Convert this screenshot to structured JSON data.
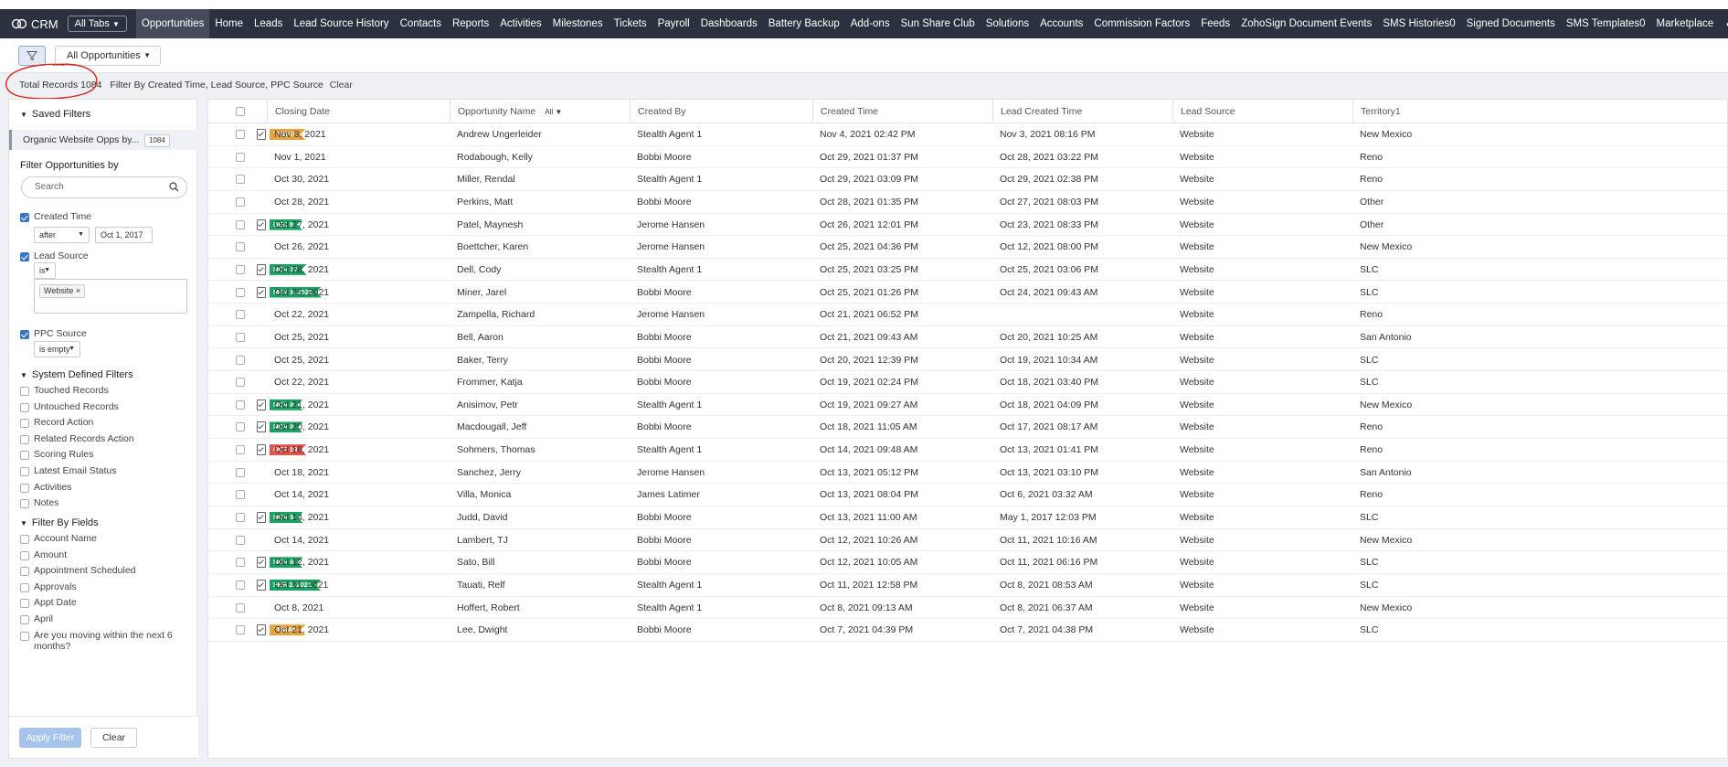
{
  "app": {
    "logo_text": "CRM",
    "all_tabs_label": "All Tabs"
  },
  "nav": {
    "tabs": [
      "Opportunities",
      "Home",
      "Leads",
      "Lead Source History",
      "Contacts",
      "Reports",
      "Activities",
      "Milestones",
      "Tickets",
      "Payroll",
      "Dashboards",
      "Battery Backup",
      "Add-ons",
      "Sun Share Club",
      "Solutions",
      "Accounts",
      "Commission Factors",
      "Feeds",
      "ZohoSign Document Events",
      "SMS Histories0",
      "Signed Documents",
      "SMS Templates0",
      "Marketplace"
    ],
    "active": "Opportunities",
    "more": "•••"
  },
  "toolbar": {
    "view_label": "All Opportunities"
  },
  "info": {
    "total_label": "Total Records",
    "total_value": "1084",
    "filter_text": "Filter By Created Time, Lead Source, PPC Source",
    "clear_label": "Clear"
  },
  "sidebar": {
    "saved_filters_label": "Saved Filters",
    "saved_item_label": "Organic Website Opps by...",
    "saved_item_count": "1084",
    "filter_by_label": "Filter Opportunities by",
    "search_placeholder": "Search",
    "created_time": {
      "label": "Created Time",
      "operator": "after",
      "value": "Oct 1, 2017"
    },
    "lead_source": {
      "label": "Lead Source",
      "operator": "is",
      "token": "Website"
    },
    "ppc_source": {
      "label": "PPC Source",
      "operator": "is empty"
    },
    "system_filters_label": "System Defined Filters",
    "system_filters": [
      "Touched Records",
      "Untouched Records",
      "Record Action",
      "Related Records Action",
      "Scoring Rules",
      "Latest Email Status",
      "Activities",
      "Notes"
    ],
    "field_filters_label": "Filter By Fields",
    "field_filters": [
      "Account Name",
      "Amount",
      "Appointment Scheduled",
      "Approvals",
      "Appt Date",
      "April",
      "Are you moving within the next 6 months?"
    ],
    "apply_label": "Apply Filter",
    "clear_label": "Clear"
  },
  "table": {
    "columns": [
      "Closing Date",
      "Opportunity Name",
      "Created By",
      "Created Time",
      "Lead Created Time",
      "Lead Source",
      "Territory1"
    ],
    "name_filter": "All",
    "rows": [
      {
        "tag": "TODAY",
        "tag_color": "#e8a33c",
        "closing": "Nov 8, 2021",
        "name": "Andrew Ungerleider",
        "created_by": "Stealth Agent 1",
        "created_time": "Nov 4, 2021 02:42 PM",
        "lead_created": "Nov 3, 2021 08:16 PM",
        "source": "Website",
        "territory": "New Mexico"
      },
      {
        "tag": "",
        "tag_color": "",
        "closing": "Nov 1, 2021",
        "name": "Rodabough, Kelly",
        "created_by": "Bobbi Moore",
        "created_time": "Oct 29, 2021 01:37 PM",
        "lead_created": "Oct 28, 2021 03:22 PM",
        "source": "Website",
        "territory": "Reno"
      },
      {
        "tag": "",
        "tag_color": "",
        "closing": "Oct 30, 2021",
        "name": "Miller, Rendal",
        "created_by": "Stealth Agent 1",
        "created_time": "Oct 29, 2021 03:09 PM",
        "lead_created": "Oct 29, 2021 02:38 PM",
        "source": "Website",
        "territory": "Reno"
      },
      {
        "tag": "",
        "tag_color": "",
        "closing": "Oct 28, 2021",
        "name": "Perkins, Matt",
        "created_by": "Bobbi Moore",
        "created_time": "Oct 28, 2021 01:35 PM",
        "lead_created": "Oct 27, 2021 08:03 PM",
        "source": "Website",
        "territory": "Other"
      },
      {
        "tag": "DEC 8",
        "tag_color": "#1aa260",
        "closing": "Oct 27, 2021",
        "name": "Patel, Maynesh",
        "created_by": "Jerome Hansen",
        "created_time": "Oct 26, 2021 12:01 PM",
        "lead_created": "Oct 23, 2021 08:33 PM",
        "source": "Website",
        "territory": "Other"
      },
      {
        "tag": "",
        "tag_color": "",
        "closing": "Oct 26, 2021",
        "name": "Boettcher, Karen",
        "created_by": "Jerome Hansen",
        "created_time": "Oct 25, 2021 04:36 PM",
        "lead_created": "Oct 12, 2021 08:00 PM",
        "source": "Website",
        "territory": "New Mexico"
      },
      {
        "tag": "NOV 17",
        "tag_color": "#1aa260",
        "closing": "Oct 28, 2021",
        "name": "Dell, Cody",
        "created_by": "Stealth Agent 1",
        "created_time": "Oct 25, 2021 03:25 PM",
        "lead_created": "Oct 25, 2021 03:06 PM",
        "source": "Website",
        "territory": "SLC"
      },
      {
        "tag": "MAY 3, 2022",
        "tag_color": "#1aa260",
        "closing": "Oct 25, 2021",
        "name": "Miner, Jarel",
        "created_by": "Bobbi Moore",
        "created_time": "Oct 25, 2021 01:26 PM",
        "lead_created": "Oct 24, 2021 09:43 AM",
        "source": "Website",
        "territory": "SLC"
      },
      {
        "tag": "",
        "tag_color": "",
        "closing": "Oct 22, 2021",
        "name": "Zampella, Richard",
        "created_by": "Jerome Hansen",
        "created_time": "Oct 21, 2021 06:52 PM",
        "lead_created": "",
        "source": "Website",
        "territory": "Reno"
      },
      {
        "tag": "",
        "tag_color": "",
        "closing": "Oct 25, 2021",
        "name": "Bell, Aaron",
        "created_by": "Bobbi Moore",
        "created_time": "Oct 21, 2021 09:43 AM",
        "lead_created": "Oct 20, 2021 10:25 AM",
        "source": "Website",
        "territory": "San Antonio"
      },
      {
        "tag": "",
        "tag_color": "",
        "closing": "Oct 25, 2021",
        "name": "Baker, Terry",
        "created_by": "Bobbi Moore",
        "created_time": "Oct 20, 2021 12:39 PM",
        "lead_created": "Oct 19, 2021 10:34 AM",
        "source": "Website",
        "territory": "SLC"
      },
      {
        "tag": "",
        "tag_color": "",
        "closing": "Oct 22, 2021",
        "name": "Frommer, Katja",
        "created_by": "Bobbi Moore",
        "created_time": "Oct 19, 2021 02:24 PM",
        "lead_created": "Oct 18, 2021 03:40 PM",
        "source": "Website",
        "territory": "SLC"
      },
      {
        "tag": "NOV 8",
        "tag_color": "#1aa260",
        "closing": "Oct 21, 2021",
        "name": "Anisimov, Petr",
        "created_by": "Stealth Agent 1",
        "created_time": "Oct 19, 2021 09:27 AM",
        "lead_created": "Oct 18, 2021 04:09 PM",
        "source": "Website",
        "territory": "New Mexico"
      },
      {
        "tag": "NOV 8",
        "tag_color": "#1aa260",
        "closing": "Oct 20, 2021",
        "name": "Macdougall, Jeff",
        "created_by": "Bobbi Moore",
        "created_time": "Oct 18, 2021 11:05 AM",
        "lead_created": "Oct 17, 2021 08:17 AM",
        "source": "Website",
        "territory": "Reno"
      },
      {
        "tag": "OCT 19",
        "tag_color": "#e5534b",
        "closing": "Oct 16, 2021",
        "name": "Sohmers, Thomas",
        "created_by": "Stealth Agent 1",
        "created_time": "Oct 14, 2021 09:48 AM",
        "lead_created": "Oct 13, 2021 01:41 PM",
        "source": "Website",
        "territory": "Reno"
      },
      {
        "tag": "",
        "tag_color": "",
        "closing": "Oct 18, 2021",
        "name": "Sanchez, Jerry",
        "created_by": "Jerome Hansen",
        "created_time": "Oct 13, 2021 05:12 PM",
        "lead_created": "Oct 13, 2021 03:10 PM",
        "source": "Website",
        "territory": "San Antonio"
      },
      {
        "tag": "",
        "tag_color": "",
        "closing": "Oct 14, 2021",
        "name": "Villa, Monica",
        "created_by": "James Latimer",
        "created_time": "Oct 13, 2021 08:04 PM",
        "lead_created": "Oct 6, 2021 03:32 AM",
        "source": "Website",
        "territory": "Reno"
      },
      {
        "tag": "NOV 5",
        "tag_color": "#1aa260",
        "closing": "Oct 14, 2021",
        "name": "Judd, David",
        "created_by": "Bobbi Moore",
        "created_time": "Oct 13, 2021 11:00 AM",
        "lead_created": "May 1, 2017 12:03 PM",
        "source": "Website",
        "territory": "SLC"
      },
      {
        "tag": "",
        "tag_color": "",
        "closing": "Oct 14, 2021",
        "name": "Lambert, TJ",
        "created_by": "Bobbi Moore",
        "created_time": "Oct 12, 2021 10:26 AM",
        "lead_created": "Oct 11, 2021 10:16 AM",
        "source": "Website",
        "territory": "New Mexico"
      },
      {
        "tag": "NOV 8",
        "tag_color": "#1aa260",
        "closing": "Oct 12, 2021",
        "name": "Sato, Bill",
        "created_by": "Bobbi Moore",
        "created_time": "Oct 12, 2021 10:05 AM",
        "lead_created": "Oct 11, 2021 06:16 PM",
        "source": "Website",
        "territory": "SLC"
      },
      {
        "tag": "FEB 2, 2022",
        "tag_color": "#1aa260",
        "closing": "Oct 11, 2021",
        "name": "Tauati, Relf",
        "created_by": "Stealth Agent 1",
        "created_time": "Oct 11, 2021 12:58 PM",
        "lead_created": "Oct 8, 2021 08:53 AM",
        "source": "Website",
        "territory": "SLC"
      },
      {
        "tag": "",
        "tag_color": "",
        "closing": "Oct 8, 2021",
        "name": "Hoffert, Robert",
        "created_by": "Stealth Agent 1",
        "created_time": "Oct 8, 2021 09:13 AM",
        "lead_created": "Oct 8, 2021 06:37 AM",
        "source": "Website",
        "territory": "New Mexico"
      },
      {
        "tag": "TODAY",
        "tag_color": "#e8a33c",
        "closing": "Oct 21, 2021",
        "name": "Lee, Dwight",
        "created_by": "Bobbi Moore",
        "created_time": "Oct 7, 2021 04:39 PM",
        "lead_created": "Oct 7, 2021 04:38 PM",
        "source": "Website",
        "territory": "SLC"
      }
    ]
  },
  "colors": {
    "nav_bg": "#2c3140",
    "today_tag": "#e8a33c",
    "future_tag": "#1aa260",
    "overdue_tag": "#e5534b",
    "annotation": "#d9261c"
  }
}
